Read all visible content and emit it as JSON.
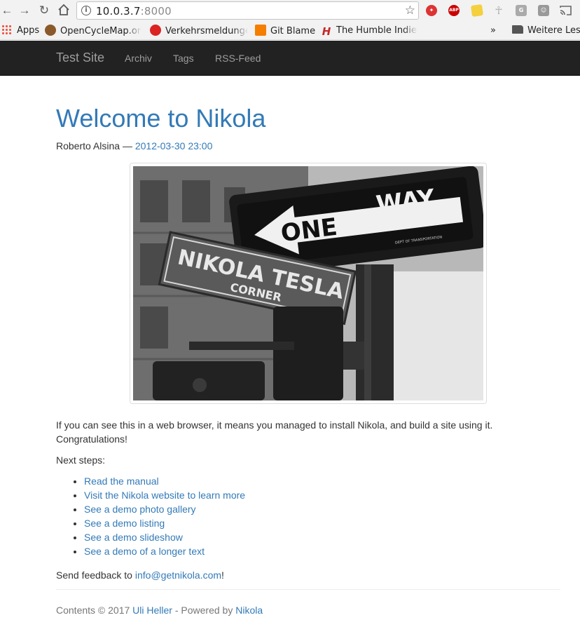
{
  "browser": {
    "url_host": "10.0.3.7",
    "url_port": ":8000",
    "bookmarks": [
      {
        "label": "Apps"
      },
      {
        "label": "OpenCycleMap.org"
      },
      {
        "label": "Verkehrsmeldungen"
      },
      {
        "label": "Git Blame"
      },
      {
        "label": "The Humble Indie Bundle"
      }
    ],
    "overflow_label": "»",
    "other_bookmarks_label": "Weitere Lesezeichen",
    "extensions": {
      "abp_label": "ABP",
      "g_label": "G"
    }
  },
  "navbar": {
    "brand": "Test Site",
    "links": [
      "Archiv",
      "Tags",
      "RSS-Feed"
    ]
  },
  "post": {
    "title": "Welcome to Nikola",
    "author": "Roberto Alsina",
    "separator": " — ",
    "date": "2012-03-30 23:00",
    "image": {
      "sign_one_way_1": "ONE",
      "sign_one_way_2": "WAY",
      "sign_dept": "DEPT OF TRANSPORTATION",
      "sign_street_1": "NIKOLA TESLA",
      "sign_street_2": "CORNER"
    },
    "intro": "If you can see this in a web browser, it means you managed to install Nikola, and build a site using it. Congratulations!",
    "next_steps_label": "Next steps:",
    "steps": [
      "Read the manual",
      "Visit the Nikola website to learn more",
      "See a demo photo gallery",
      "See a demo listing",
      "See a demo slideshow",
      "See a demo of a longer text"
    ],
    "feedback_prefix": "Send feedback to ",
    "feedback_email": "info@getnikola.com",
    "feedback_suffix": "!"
  },
  "footer": {
    "prefix": "Contents © 2017 ",
    "author": "Uli Heller",
    "middle": " - Powered by ",
    "powered": "Nikola"
  },
  "colors": {
    "link": "#337ab7",
    "navbar_bg": "#222222",
    "navbar_text": "#9d9d9d"
  }
}
